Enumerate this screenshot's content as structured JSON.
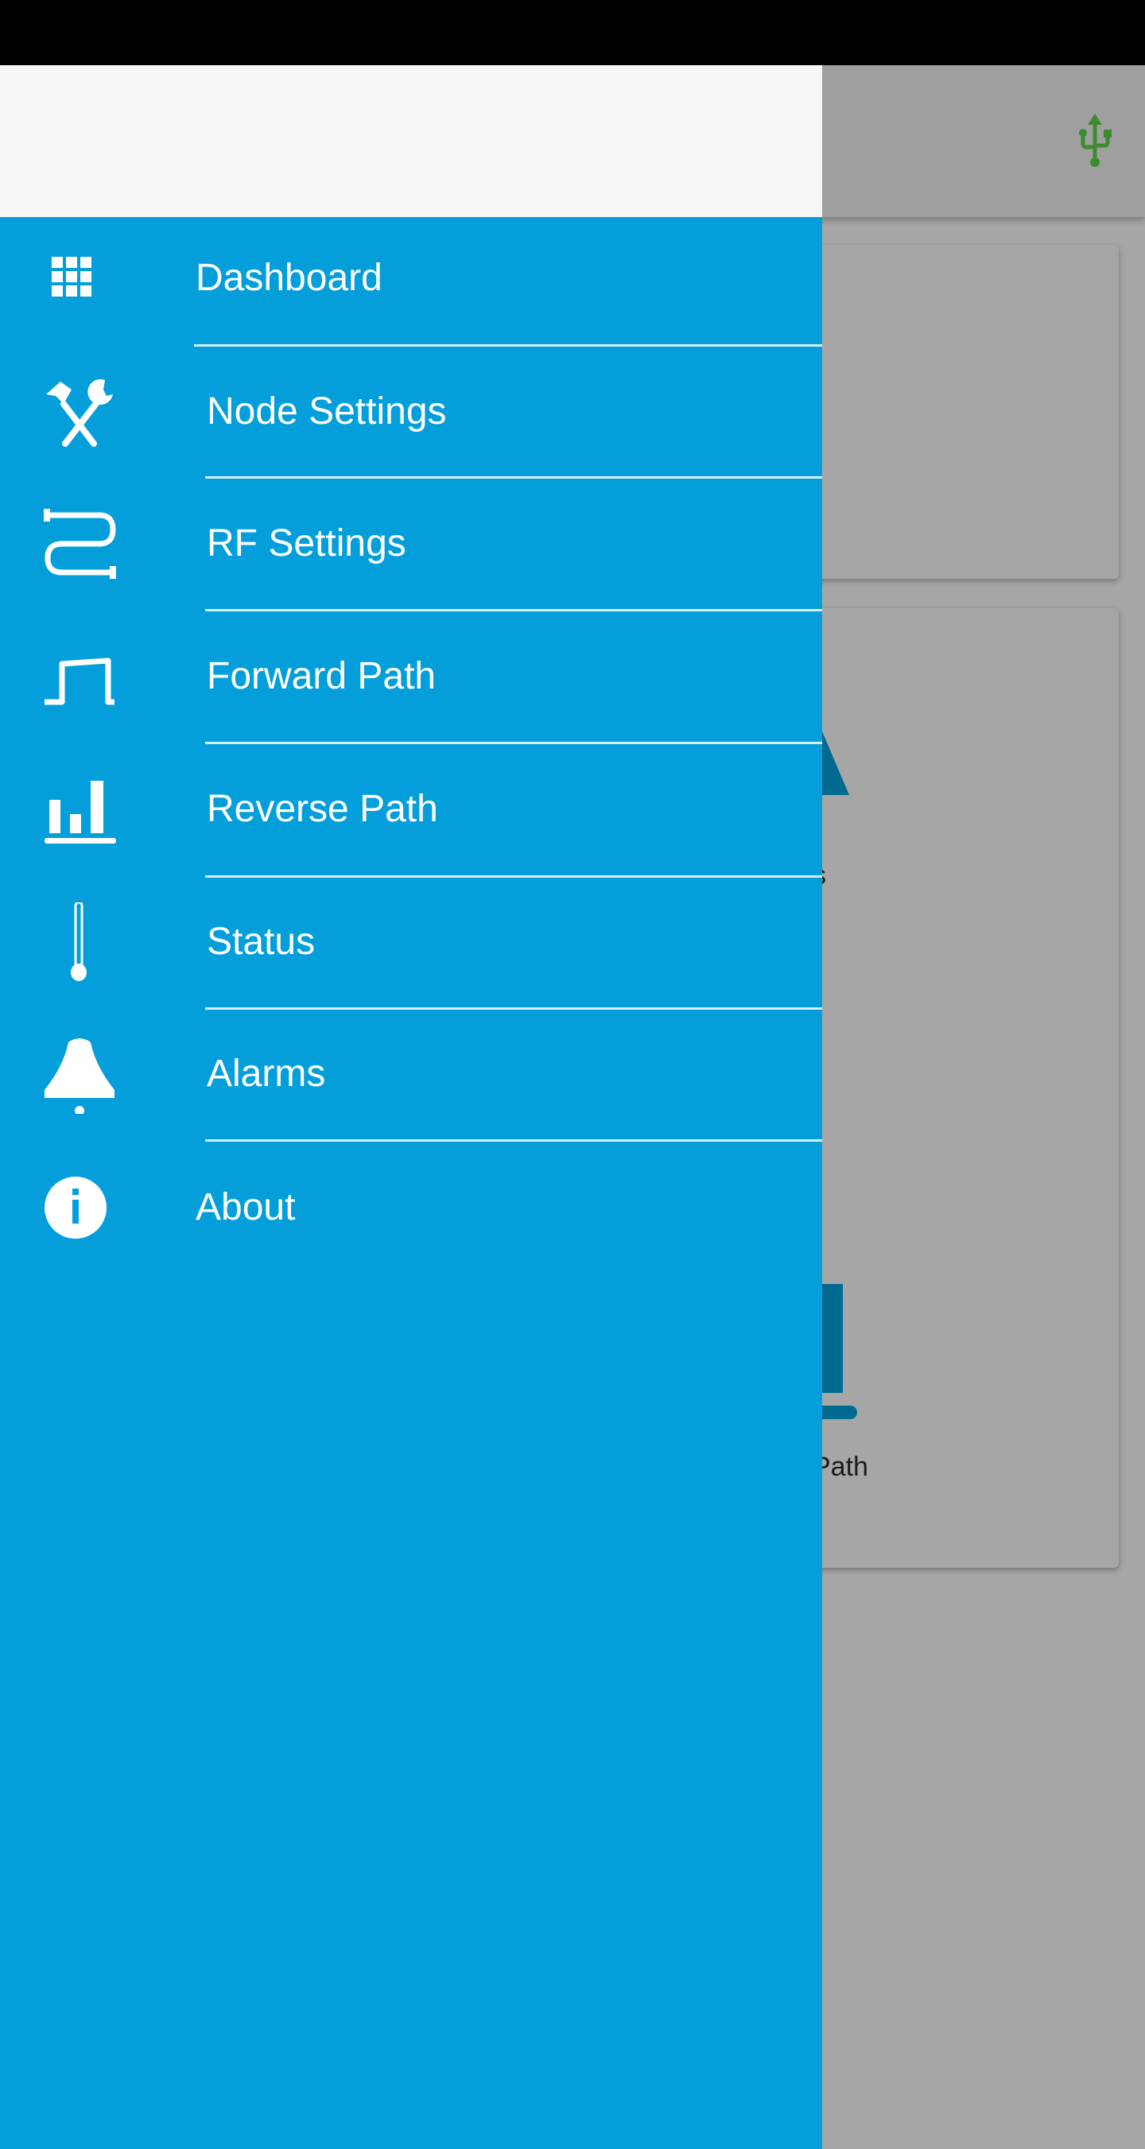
{
  "app_bar": {
    "usb_icon": "usb-icon",
    "usb_color": "#3d8b2f"
  },
  "background_cards": {
    "partial_label_1": "s",
    "partial_label_2": "Path"
  },
  "drawer": {
    "accent": "#049fda",
    "items": [
      {
        "label": "Dashboard",
        "icon": "grid-icon"
      },
      {
        "label": "Node Settings",
        "icon": "tools-icon"
      },
      {
        "label": "RF Settings",
        "icon": "cable-icon"
      },
      {
        "label": "Forward Path",
        "icon": "pulse-icon"
      },
      {
        "label": "Reverse Path",
        "icon": "bar-chart-icon"
      },
      {
        "label": "Status",
        "icon": "thermometer-icon"
      },
      {
        "label": "Alarms",
        "icon": "bell-icon"
      },
      {
        "label": "About",
        "icon": "info-icon"
      }
    ]
  }
}
